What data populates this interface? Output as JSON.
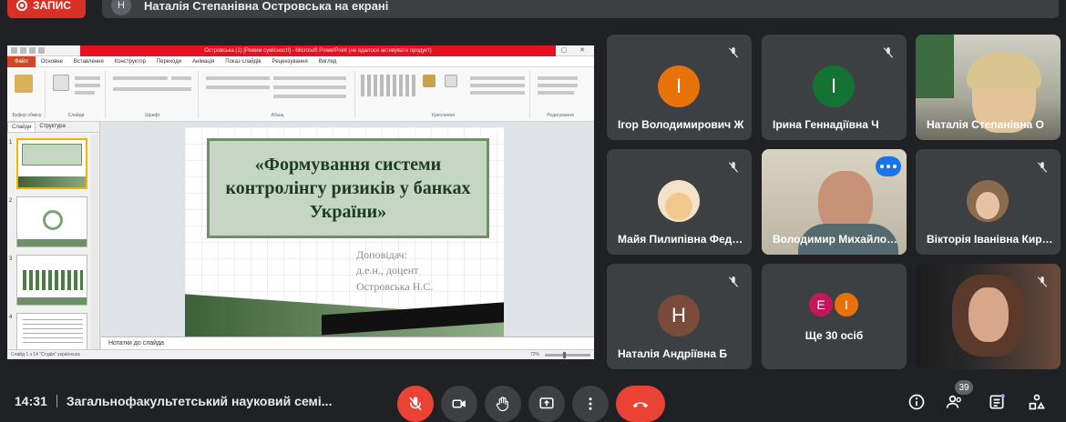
{
  "top": {
    "record_label": "ЗАПИС",
    "presenter_initial": "Н",
    "presenting_text": "Наталія Степанівна Островська на екрані"
  },
  "powerpoint": {
    "window_title": "Островська (1) [Режим сумісності] - Microsoft PowerPoint (не вдалося активувати продукт)",
    "tabs": [
      "Файл",
      "Основне",
      "Вставлення",
      "Конструктор",
      "Переходи",
      "Анімація",
      "Показ слайдів",
      "Рецензування",
      "Вигляд"
    ],
    "ribbon_groups": [
      "Буфер обміну",
      "Слайди",
      "Шрифт",
      "Абзац",
      "Креслення",
      "Редагування"
    ],
    "side_tabs": [
      "Слайди",
      "Структура"
    ],
    "slide_title": "«Формування системи контролінгу ризиків у банках України»",
    "speaker_lines": [
      "Доповідач:",
      "д.е.н., доцент",
      "Островська Н.С."
    ],
    "notes_placeholder": "Нотатки до слайда",
    "status_left": "Слайд 1 з 14   \"Студія\"   українська",
    "zoom": "72%"
  },
  "participants": [
    {
      "name": "Ігор Володимирович Ж",
      "initial": "І",
      "color": "#e8710a",
      "muted": true
    },
    {
      "name": "Ірина Геннадіївна Ч",
      "initial": "І",
      "color": "#137333",
      "muted": true
    },
    {
      "name": "Наталія Степанівна О",
      "initial": "",
      "color": "",
      "muted": false
    },
    {
      "name": "Майя Пилипівна Федорова",
      "initial": "",
      "color": "",
      "muted": true
    },
    {
      "name": "Володимир Михайлович",
      "initial": "",
      "color": "",
      "muted": false
    },
    {
      "name": "Вікторія Іванівна Кирилова",
      "initial": "",
      "color": "",
      "muted": true
    },
    {
      "name": "Наталія Андріївна Б",
      "initial": "Н",
      "color": "#7a4b3a",
      "muted": true
    },
    {
      "name": "Ще 30 осіб",
      "initial": "",
      "color": "",
      "muted": false
    },
    {
      "name": "",
      "initial": "",
      "color": "",
      "muted": true
    }
  ],
  "more": {
    "initial_a": "Е",
    "initial_b": "І",
    "color_a": "#c2185b",
    "color_b": "#e8710a",
    "label": "Ще 30 осіб"
  },
  "bottom": {
    "time": "14:31",
    "meeting_title": "Загальнофакультетський науковий семі...",
    "participant_count": "39"
  }
}
